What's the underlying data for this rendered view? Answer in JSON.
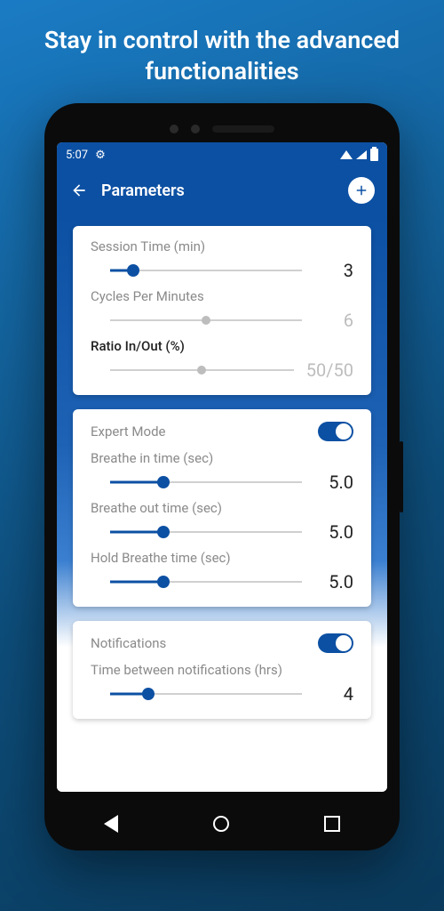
{
  "headline": "Stay in control with the advanced functionalities",
  "statusbar": {
    "time": "5:07"
  },
  "appbar": {
    "title": "Parameters"
  },
  "card1": {
    "session": {
      "label": "Session Time (min)",
      "value": "3",
      "pos": 12
    },
    "cycles": {
      "label": "Cycles Per Minutes",
      "value": "6",
      "pos": 50
    },
    "ratio": {
      "label": "Ratio In/Out (%)",
      "value": "50/50",
      "pos": 50
    }
  },
  "card2": {
    "expert": {
      "label": "Expert Mode"
    },
    "in": {
      "label": "Breathe in time (sec)",
      "value": "5.0",
      "pos": 28
    },
    "out": {
      "label": "Breathe out time (sec)",
      "value": "5.0",
      "pos": 28
    },
    "hold": {
      "label": "Hold Breathe time (sec)",
      "value": "5.0",
      "pos": 28
    }
  },
  "card3": {
    "notif": {
      "label": "Notifications"
    },
    "gap": {
      "label": "Time between notifications (hrs)",
      "value": "4",
      "pos": 20
    }
  }
}
